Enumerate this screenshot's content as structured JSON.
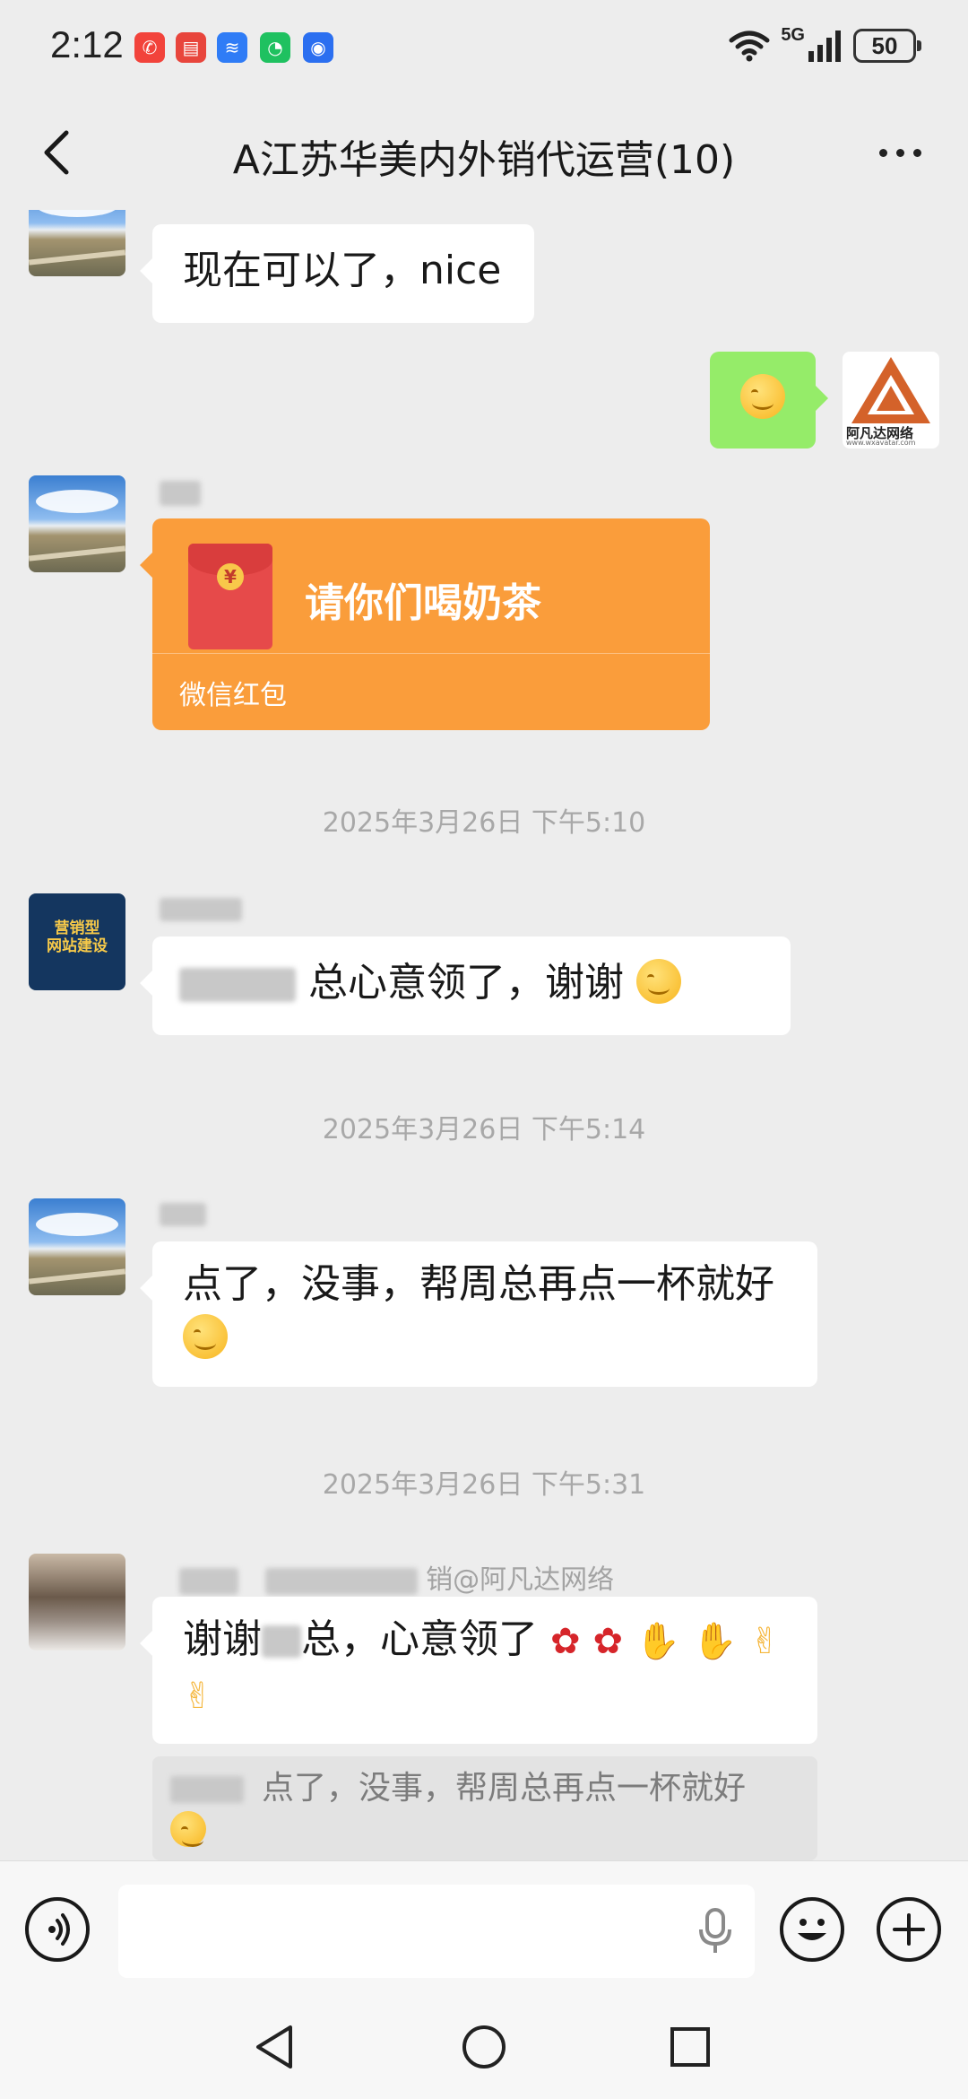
{
  "status_bar": {
    "time": "2:12",
    "network": "5G",
    "battery": "50"
  },
  "header": {
    "title": "A江苏华美内外销代运营(10)"
  },
  "messages": [
    {
      "text": "现在可以了，nice"
    },
    {
      "emoji": "smile-emoji"
    },
    {
      "type": "red-packet",
      "title": "请你们喝奶茶",
      "subtitle": "微信红包"
    },
    {
      "timestamp": "2025年3月26日 下午5:10"
    },
    {
      "text_end": "总心意领了，谢谢"
    },
    {
      "timestamp": "2025年3月26日 下午5:14"
    },
    {
      "text": "点了，没事，帮周总再点一杯就好"
    },
    {
      "timestamp": "2025年3月26日 下午5:31"
    },
    {
      "sender_suffix": "销@阿凡达网络",
      "text_a": "谢谢",
      "text_b": "总，心意领了",
      "quote": "点了，没事，帮周总再点一杯就好"
    }
  ],
  "self_avatar": {
    "brand_text": "阿凡达网络",
    "url_text": "www.wxavatar.com"
  },
  "ad_avatar": {
    "line1": "营销型",
    "line2": "网站建设"
  },
  "input": {
    "placeholder": ""
  },
  "colors": {
    "background": "#ededed",
    "self_bubble": "#95ec69",
    "red_packet": "#fa9d3b"
  }
}
